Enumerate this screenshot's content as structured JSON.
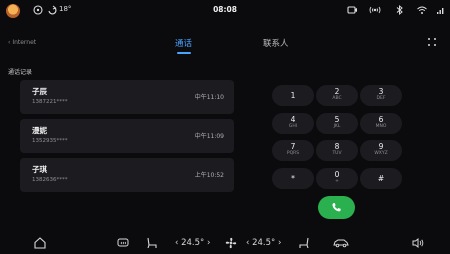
{
  "statusbar": {
    "temperature": "18°",
    "time": "08:08"
  },
  "header": {
    "source_label": "Internet",
    "tabs": [
      {
        "label": "通话",
        "active": true
      },
      {
        "label": "联系人",
        "active": false
      }
    ],
    "accent_color": "#4aa3ff"
  },
  "section_title": "通话记录",
  "calls": [
    {
      "name": "子辰",
      "number": "1387221****",
      "time": "中午11:10"
    },
    {
      "name": "漫妮",
      "number": "1352935****",
      "time": "中午11:09"
    },
    {
      "name": "子琪",
      "number": "1382636****",
      "time": "上午10:52"
    }
  ],
  "dialpad": {
    "keys": [
      {
        "digit": "1",
        "letters": ""
      },
      {
        "digit": "2",
        "letters": "ABC"
      },
      {
        "digit": "3",
        "letters": "DEF"
      },
      {
        "digit": "4",
        "letters": "GHI"
      },
      {
        "digit": "5",
        "letters": "JKL"
      },
      {
        "digit": "6",
        "letters": "MNO"
      },
      {
        "digit": "7",
        "letters": "PQRS"
      },
      {
        "digit": "8",
        "letters": "TUV"
      },
      {
        "digit": "9",
        "letters": "WXYZ"
      },
      {
        "digit": "*",
        "letters": ""
      },
      {
        "digit": "0",
        "letters": "+"
      },
      {
        "digit": "#",
        "letters": ""
      }
    ],
    "call_button_color": "#2bb04f",
    "call_icon": "phone-icon"
  },
  "dock": {
    "left_temperature": "24.5°",
    "right_temperature": "24.5°",
    "icons": [
      "home-icon",
      "rear-defrost-icon",
      "seat-heat-icon",
      "fan-icon",
      "seat-heat-icon",
      "car-icon",
      "volume-icon"
    ]
  }
}
